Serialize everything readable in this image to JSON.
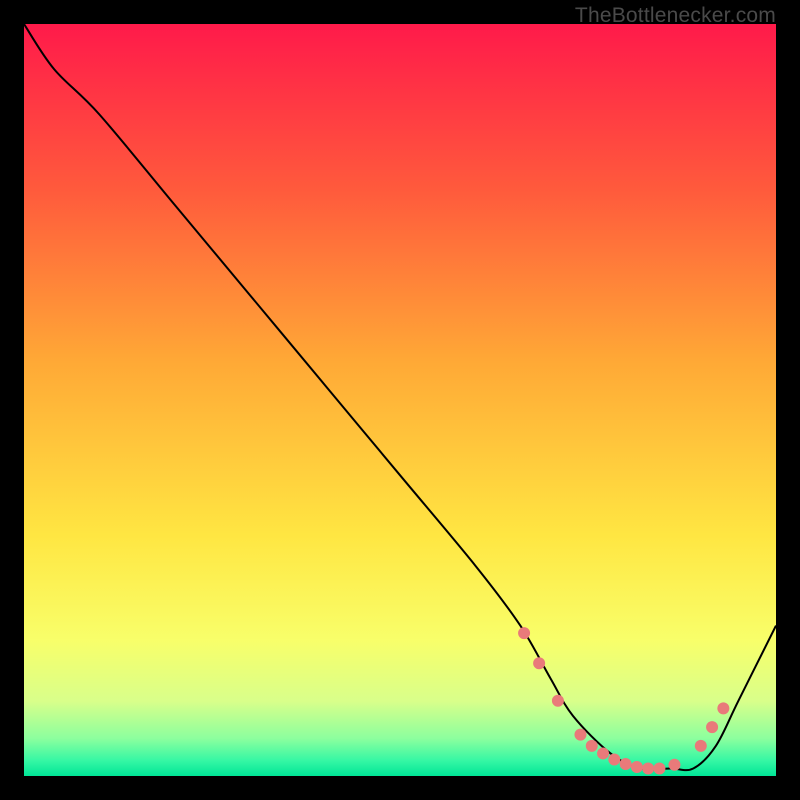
{
  "watermark": "TheBottlenecker.com",
  "chart_data": {
    "type": "line",
    "title": "",
    "xlabel": "",
    "ylabel": "",
    "xlim": [
      0,
      100
    ],
    "ylim": [
      0,
      100
    ],
    "grid": false,
    "background": {
      "type": "vertical-gradient",
      "stops": [
        {
          "offset": 0.0,
          "color": "#ff1a4a"
        },
        {
          "offset": 0.22,
          "color": "#ff5a3c"
        },
        {
          "offset": 0.45,
          "color": "#ffa936"
        },
        {
          "offset": 0.68,
          "color": "#ffe642"
        },
        {
          "offset": 0.82,
          "color": "#f8ff6a"
        },
        {
          "offset": 0.9,
          "color": "#d9ff8a"
        },
        {
          "offset": 0.95,
          "color": "#8cff9e"
        },
        {
          "offset": 0.98,
          "color": "#34f7a4"
        },
        {
          "offset": 1.0,
          "color": "#00e597"
        }
      ]
    },
    "series": [
      {
        "name": "curve",
        "color": "#000000",
        "width": 2,
        "x": [
          0,
          4,
          10,
          20,
          30,
          40,
          50,
          60,
          66,
          70,
          73,
          78,
          82,
          86,
          89,
          92,
          95,
          100
        ],
        "y": [
          100,
          94,
          88,
          76,
          64,
          52,
          40,
          28,
          20,
          13,
          8,
          3,
          1,
          1,
          1,
          4,
          10,
          20
        ]
      }
    ],
    "markers": {
      "color": "#e97a7a",
      "radius": 6,
      "points": [
        {
          "x": 66.5,
          "y": 19
        },
        {
          "x": 68.5,
          "y": 15
        },
        {
          "x": 71,
          "y": 10
        },
        {
          "x": 74,
          "y": 5.5
        },
        {
          "x": 75.5,
          "y": 4
        },
        {
          "x": 77,
          "y": 3
        },
        {
          "x": 78.5,
          "y": 2.2
        },
        {
          "x": 80,
          "y": 1.6
        },
        {
          "x": 81.5,
          "y": 1.2
        },
        {
          "x": 83,
          "y": 1
        },
        {
          "x": 84.5,
          "y": 1
        },
        {
          "x": 86.5,
          "y": 1.5
        },
        {
          "x": 90,
          "y": 4
        },
        {
          "x": 91.5,
          "y": 6.5
        },
        {
          "x": 93,
          "y": 9
        }
      ]
    }
  }
}
